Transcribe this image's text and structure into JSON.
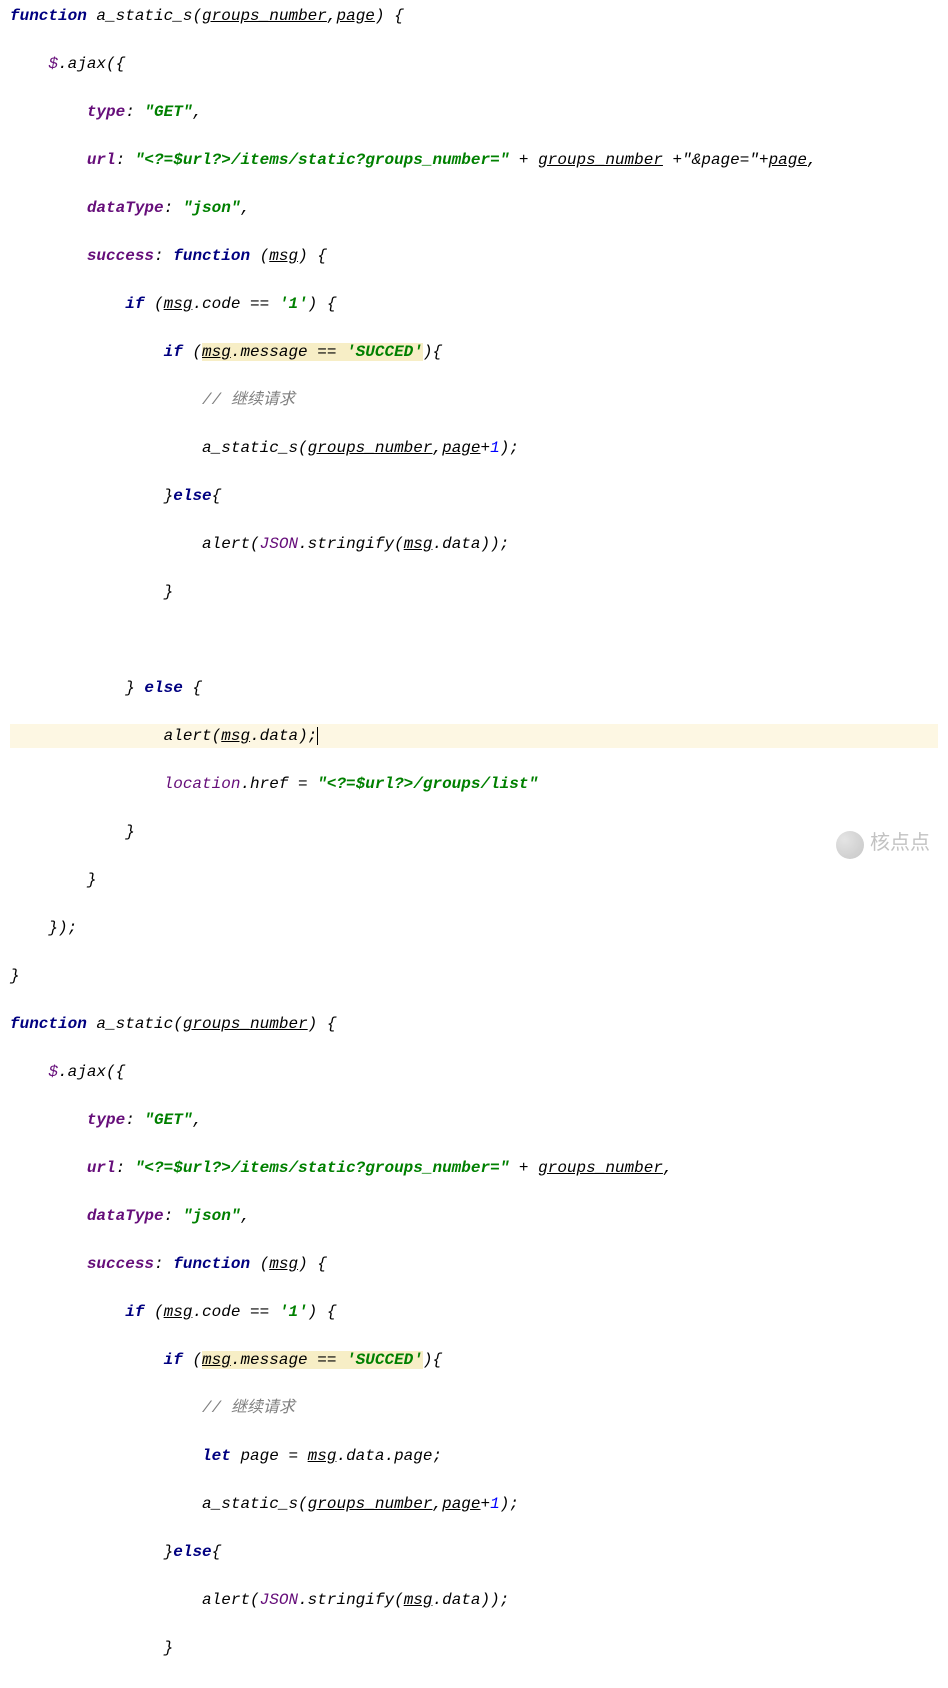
{
  "code": {
    "fn1_decl": {
      "kw_function": "function",
      "name": "a_static_s",
      "p1": "groups_number",
      "p2": "page"
    },
    "jq_ajax": "$.ajax({",
    "type_key": "type",
    "type_val": "\"GET\"",
    "url_key": "url",
    "url_seg1": "\"<?=$url?>/items/static?groups_number=\"",
    "url_plus": " + ",
    "url_gn": "groups_number",
    "url_seg2": " +\"&page=\"+",
    "url_page": "page",
    "datatype_key": "dataType",
    "datatype_val": "\"json\"",
    "success_key": "success",
    "success_fn": "function",
    "success_arg": "msg",
    "if_code": "if (",
    "msg": "msg",
    "dot_code": ".code",
    "eq": " == ",
    "one": "'1'",
    "close_if": ") {",
    "if_msg": "if (",
    "dot_message": ".message",
    "succed": "'SUCCED'",
    "close_if2": "){",
    "comment_continue": "// 继续请求",
    "call_self": "a_static_s",
    "plus1": "+",
    "num1": "1",
    "else_kw": "}else{",
    "alert": "alert",
    "json_stringify": "JSON",
    "dot_stringify": ".stringify(",
    "dot_data": ".data",
    "else_top": "} else {",
    "alert_data": "alert(",
    "msg_data": "msg",
    "d_data": ".data",
    "end_alert": ");",
    "location": "location",
    "dot_href": ".href = ",
    "redirect": "\"<?=$url?>/groups/list\"",
    "close_brace": "}",
    "close_ajax": "});",
    "fn2_decl": {
      "kw_function": "function",
      "name": "a_static",
      "p1": "groups_number"
    },
    "url2_seg1": "\"<?=$url?>/items/static?groups_number=\"",
    "url2_gn": "groups_number",
    "let_kw": "let",
    "page_var": " page = ",
    "msg_data_page": ".data.page;",
    "call_s2": "a_static_s"
  },
  "watermark": "核点点"
}
